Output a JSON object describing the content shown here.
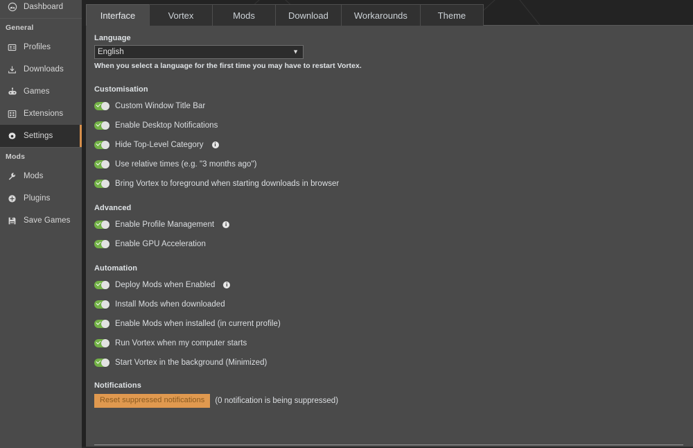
{
  "sidebar": {
    "top_item": {
      "label": "Dashboard",
      "icon": "dashboard-icon"
    },
    "groups": [
      {
        "title": "General",
        "items": [
          {
            "label": "Profiles",
            "icon": "profiles-icon",
            "active": false
          },
          {
            "label": "Downloads",
            "icon": "downloads-icon",
            "active": false
          },
          {
            "label": "Games",
            "icon": "games-icon",
            "active": false
          },
          {
            "label": "Extensions",
            "icon": "extensions-icon",
            "active": false
          },
          {
            "label": "Settings",
            "icon": "gear-icon",
            "active": true
          }
        ]
      },
      {
        "title": "Mods",
        "items": [
          {
            "label": "Mods",
            "icon": "wrench-icon",
            "active": false
          },
          {
            "label": "Plugins",
            "icon": "plugins-icon",
            "active": false
          },
          {
            "label": "Save Games",
            "icon": "save-icon",
            "active": false
          }
        ]
      }
    ],
    "active_accent_color": "#d78f4b"
  },
  "tabs": [
    {
      "label": "Interface",
      "active": true
    },
    {
      "label": "Vortex",
      "active": false
    },
    {
      "label": "Mods",
      "active": false
    },
    {
      "label": "Download",
      "active": false
    },
    {
      "label": "Workarounds",
      "active": false
    },
    {
      "label": "Theme",
      "active": false
    }
  ],
  "interface": {
    "language": {
      "label": "Language",
      "selected": "English",
      "options": [
        "English"
      ],
      "help": "When you select a language for the first time you may have to restart Vortex."
    },
    "customisation": {
      "title": "Customisation",
      "toggles": [
        {
          "label": "Custom Window Title Bar",
          "on": true,
          "info": false
        },
        {
          "label": "Enable Desktop Notifications",
          "on": true,
          "info": false
        },
        {
          "label": "Hide Top-Level Category",
          "on": true,
          "info": true
        },
        {
          "label": "Use relative times (e.g. \"3 months ago\")",
          "on": true,
          "info": false
        },
        {
          "label": "Bring Vortex to foreground when starting downloads in browser",
          "on": true,
          "info": false
        }
      ]
    },
    "advanced": {
      "title": "Advanced",
      "toggles": [
        {
          "label": "Enable Profile Management",
          "on": true,
          "info": true
        },
        {
          "label": "Enable GPU Acceleration",
          "on": true,
          "info": false
        }
      ]
    },
    "automation": {
      "title": "Automation",
      "toggles": [
        {
          "label": "Deploy Mods when Enabled",
          "on": true,
          "info": true
        },
        {
          "label": "Install Mods when downloaded",
          "on": true,
          "info": false
        },
        {
          "label": "Enable Mods when installed (in current profile)",
          "on": true,
          "info": false
        },
        {
          "label": "Run Vortex when my computer starts",
          "on": true,
          "info": false
        },
        {
          "label": "Start Vortex in the background (Minimized)",
          "on": true,
          "info": false
        }
      ]
    },
    "notifications": {
      "title": "Notifications",
      "reset_button": "Reset suppressed notifications",
      "note": "(0 notification is being suppressed)",
      "button_color": "#e0994f"
    }
  },
  "colors": {
    "toggle_on": "#73b246",
    "accent": "#d78f4b",
    "panel_bg": "#4a4a4a",
    "sidebar_bg": "#4a4a4a"
  }
}
